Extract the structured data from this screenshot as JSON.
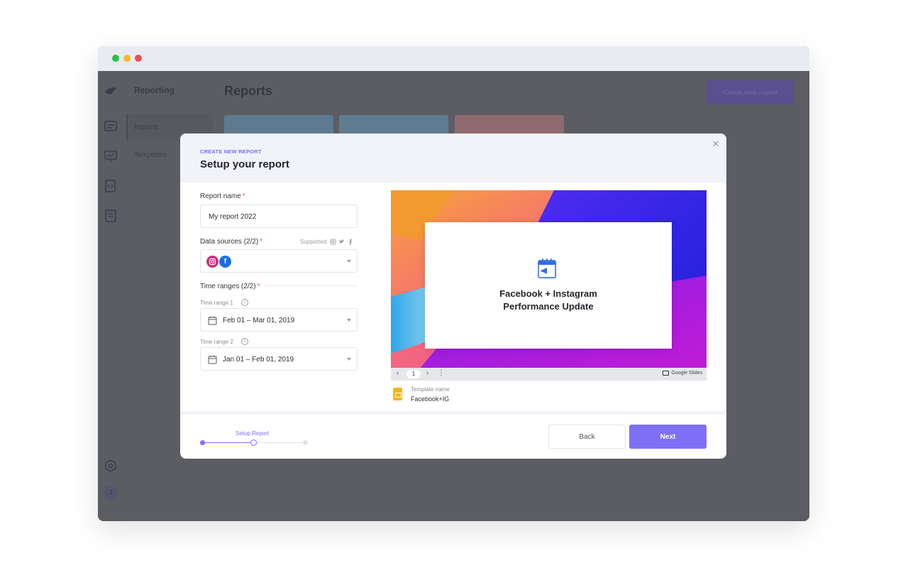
{
  "app": {
    "section_title": "Reporting",
    "nav_items": [
      "Reports",
      "Templates"
    ],
    "page_title": "Reports",
    "create_button": "Create new report",
    "avatar_initial": "J"
  },
  "modal": {
    "eyebrow": "CREATE NEW REPORT",
    "title": "Setup your report",
    "report_name": {
      "label": "Report name",
      "value": "My report 2022"
    },
    "data_sources": {
      "label": "Data sources (2/2)",
      "supported_label": "Supported:",
      "selected": [
        "instagram",
        "facebook"
      ],
      "facebook_glyph": "f"
    },
    "time_ranges": {
      "label": "Time ranges (2/2)",
      "range1": {
        "label": "Time range 1",
        "value": "Feb 01 – Mar 01, 2019"
      },
      "range2": {
        "label": "Time range 2",
        "value": "Jan 01 – Feb 01, 2019"
      }
    },
    "required_mark": "*",
    "info_glyph": "i",
    "preview": {
      "slide_title_line1": "Facebook + Instagram",
      "slide_title_line2": "Performance Update",
      "page_number": "1",
      "provider": "Google Slides"
    },
    "template": {
      "label": "Template name",
      "value": "Facebook+IG"
    },
    "stepper": {
      "current_step_label": "Setup Report",
      "current_step": 2,
      "total_steps": 3
    },
    "back_button": "Back",
    "next_button": "Next",
    "close_glyph": "✕"
  },
  "colors": {
    "accent": "#7f6ff5",
    "required": "#ef4b56",
    "instagram": "#cc2e79",
    "facebook": "#1a6fe5"
  }
}
